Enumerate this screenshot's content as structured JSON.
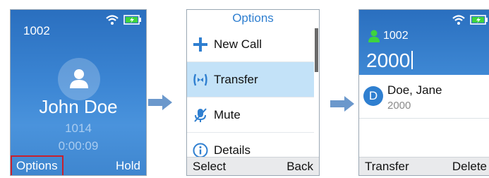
{
  "screen1": {
    "extension": "1002",
    "caller_name": "John Doe",
    "caller_number": "1014",
    "call_timer": "0:00:09",
    "softkey_left": "Options",
    "softkey_right": "Hold"
  },
  "screen2": {
    "title": "Options",
    "items": [
      {
        "label": "New Call",
        "icon": "plus-icon"
      },
      {
        "label": "Transfer",
        "icon": "transfer-icon"
      },
      {
        "label": "Mute",
        "icon": "mute-icon"
      },
      {
        "label": "Details",
        "icon": "info-icon"
      }
    ],
    "selected_index": 1,
    "softkey_left": "Select",
    "softkey_right": "Back"
  },
  "screen3": {
    "extension": "1002",
    "dial_input": "2000",
    "contact": {
      "initial": "D",
      "name": "Doe, Jane",
      "number": "2000"
    },
    "softkey_left": "Transfer",
    "softkey_right": "Delete"
  },
  "colors": {
    "accent_blue": "#2f7fd0",
    "selected_row": "#c3e2f8",
    "battery_green": "#3ed43e",
    "highlight_red": "#c8202e"
  }
}
